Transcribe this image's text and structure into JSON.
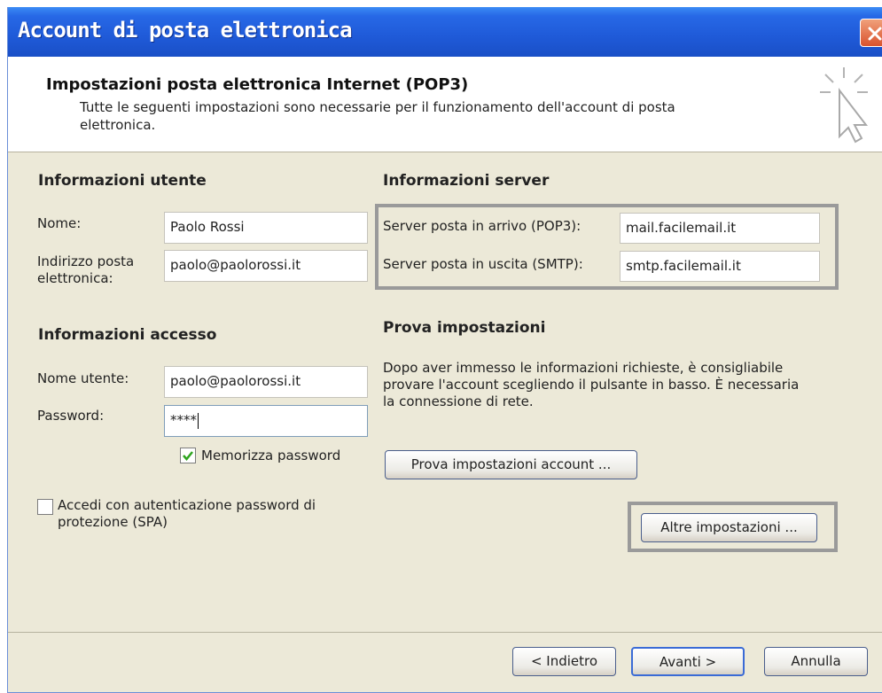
{
  "window": {
    "title": "Account di posta elettronica"
  },
  "header": {
    "title": "Impostazioni posta elettronica Internet (POP3)",
    "description": "Tutte le seguenti impostazioni sono necessarie per il funzionamento dell'account di posta elettronica."
  },
  "user_info": {
    "title": "Informazioni utente",
    "name_label": "Nome:",
    "name_value": "Paolo Rossi",
    "email_label": "Indirizzo posta elettronica:",
    "email_value": "paolo@paolorossi.it"
  },
  "server_info": {
    "title": "Informazioni server",
    "incoming_label": "Server posta in arrivo (POP3):",
    "incoming_value": "mail.facilemail.it",
    "outgoing_label": "Server posta in uscita (SMTP):",
    "outgoing_value": "smtp.facilemail.it"
  },
  "logon_info": {
    "title": "Informazioni accesso",
    "username_label": "Nome utente:",
    "username_value": "paolo@paolorossi.it",
    "password_label": "Password:",
    "password_value": "****",
    "remember_label": "Memorizza password",
    "remember_checked": true,
    "spa_label": "Accedi con autenticazione password di protezione (SPA)",
    "spa_checked": false
  },
  "test_settings": {
    "title": "Prova impostazioni",
    "description": "Dopo aver immesso le informazioni richieste, è consigliabile provare l'account scegliendo il pulsante in basso. È necessaria la connessione di rete.",
    "test_button": "Prova impostazioni account ...",
    "more_button": "Altre impostazioni ..."
  },
  "footer": {
    "back_button": "< Indietro",
    "next_button": "Avanti >",
    "cancel_button": "Annulla"
  },
  "colors": {
    "titlebar": "#2768e6",
    "body": "#ece9d8",
    "check": "#2fa51f"
  }
}
